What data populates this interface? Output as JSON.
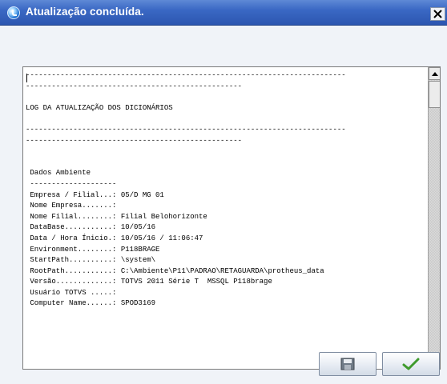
{
  "window": {
    "title": "Atualização concluída.",
    "title_bar_color": "#3a68c4"
  },
  "log": {
    "lines": [
      "--------------------------------------------------------------------------",
      "--------------------------------------------------",
      "",
      "LOG DA ATUALIZAÇÃO DOS DICIONÁRIOS",
      "",
      "--------------------------------------------------------------------------",
      "--------------------------------------------------",
      "",
      "",
      " Dados Ambiente",
      " --------------------",
      " Empresa / Filial...: 05/D MG 01",
      " Nome Empresa.......:",
      " Nome Filial........: Filial Belohorizonte",
      " DataBase...........: 10/05/16",
      " Data / Hora Ínicio.: 10/05/16 / 11:06:47",
      " Environment........: P118BRAGE",
      " StartPath..........: \\system\\",
      " RootPath...........: C:\\Ambiente\\P11\\PADRAO\\RETAGUARDA\\protheus_data",
      " Versão.............: TOTVS 2011 Série T  MSSQL P118brage",
      " Usuário TOTVS .....:",
      " Computer Name......: SPOD3169",
      ""
    ]
  },
  "buttons": {
    "save": {
      "icon": "floppy-disk-icon"
    },
    "ok": {
      "icon": "checkmark-icon",
      "icon_color": "#3f9b2d"
    }
  },
  "scrollbar": {
    "position": 0
  }
}
